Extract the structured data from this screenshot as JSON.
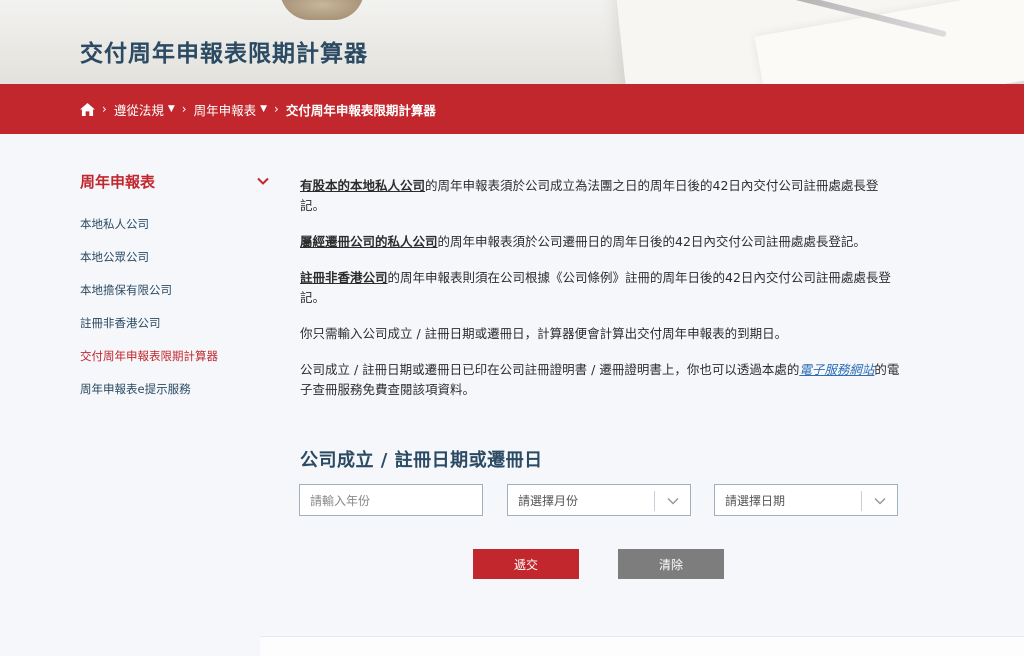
{
  "page": {
    "title": "交付周年申報表限期計算器"
  },
  "breadcrumb": {
    "items": [
      {
        "label": "遵從法規"
      },
      {
        "label": "周年申報表"
      }
    ],
    "current": "交付周年申報表限期計算器"
  },
  "sidebar": {
    "title": "周年申報表",
    "items": [
      {
        "label": "本地私人公司"
      },
      {
        "label": "本地公眾公司"
      },
      {
        "label": "本地擔保有限公司"
      },
      {
        "label": "註冊非香港公司"
      },
      {
        "label": "交付周年申報表限期計算器"
      },
      {
        "label": "周年申報表e提示服務"
      }
    ]
  },
  "content": {
    "p1_link": "有股本的本地私人公司",
    "p1_text": "的周年申報表須於公司成立為法團之日的周年日後的42日內交付公司註冊處處長登記。",
    "p2_link": "屬經遷冊公司的私人公司",
    "p2_text": "的周年申報表須於公司遷冊日的周年日後的42日內交付公司註冊處處長登記。",
    "p3_link": "註冊非香港公司",
    "p3_text": "的周年申報表則須在公司根據《公司條例》註冊的周年日後的42日內交付公司註冊處處長登記。",
    "p4_text": "你只需輸入公司成立 / 註冊日期或遷冊日，計算器便會計算出交付周年申報表的到期日。",
    "p5_text_a": "公司成立 / 註冊日期或遷冊日已印在公司註冊證明書 / 遷冊證明書上，你也可以透過本處的",
    "p5_link": "電子服務網站",
    "p5_text_b": "的電子查冊服務免費查閱該項資料。"
  },
  "form": {
    "title": "公司成立 / 註冊日期或遷冊日",
    "year_placeholder": "請輸入年份",
    "month_selected": "請選擇月份",
    "day_selected": "請選擇日期",
    "submit_label": "遞交",
    "clear_label": "清除"
  },
  "colors": {
    "brand_red": "#c1272d",
    "heading_blue": "#2b4a63",
    "link_blue": "#2f6eb5",
    "clear_gray": "#7d7d7d"
  }
}
